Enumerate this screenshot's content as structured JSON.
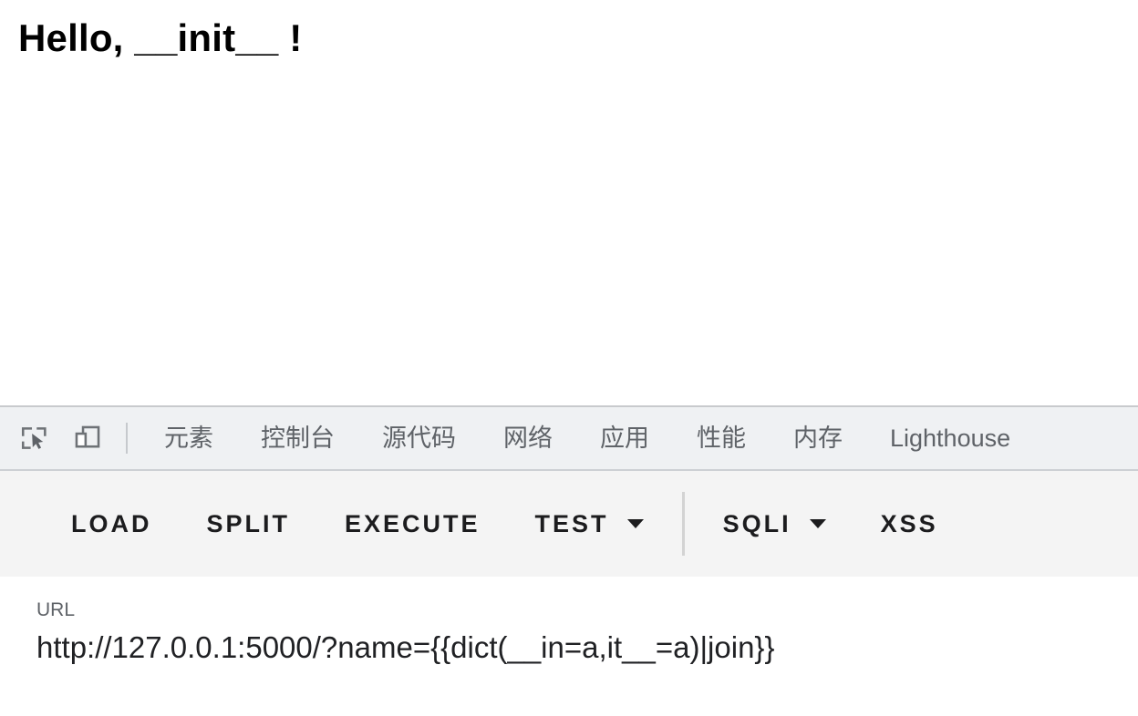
{
  "page": {
    "heading": "Hello, __init__ !"
  },
  "devtools": {
    "icons": [
      {
        "name": "inspect-element-icon",
        "label": "Inspect element"
      },
      {
        "name": "device-toolbar-icon",
        "label": "Toggle device toolbar"
      }
    ],
    "tabs": [
      {
        "label": "元素"
      },
      {
        "label": "控制台"
      },
      {
        "label": "源代码"
      },
      {
        "label": "网络"
      },
      {
        "label": "应用"
      },
      {
        "label": "性能"
      },
      {
        "label": "内存"
      },
      {
        "label": "Lighthouse"
      }
    ]
  },
  "toolbar": {
    "buttons": [
      {
        "label": "LOAD",
        "has_caret": false
      },
      {
        "label": "SPLIT",
        "has_caret": false
      },
      {
        "label": "EXECUTE",
        "has_caret": false
      },
      {
        "label": "TEST",
        "has_caret": true
      },
      {
        "label": "SQLI",
        "has_caret": true
      },
      {
        "label": "XSS",
        "has_caret": false
      }
    ]
  },
  "url_field": {
    "label": "URL",
    "value": "http://127.0.0.1:5000/?name={{dict(__in=a,it__=a)|join}}"
  },
  "colors": {
    "tabstrip_bg": "#eff1f3",
    "toolbar_bg": "#f4f4f4",
    "tab_text": "#5f6368",
    "button_text": "#1c1c1e",
    "border": "#cdd0d4"
  }
}
